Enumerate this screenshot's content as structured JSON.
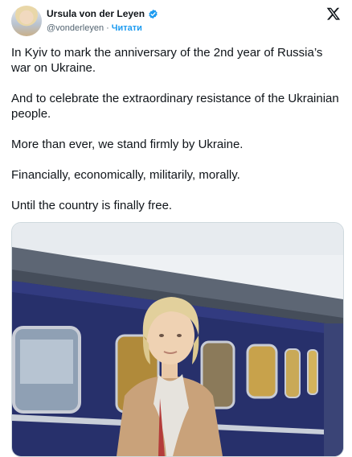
{
  "author": {
    "display_name": "Ursula von der Leyen",
    "handle": "@vonderleyen",
    "separator": "·",
    "follow_label": "Читати",
    "verified_icon": "verified-badge-icon"
  },
  "platform_icon": "x-logo-icon",
  "tweet": {
    "paragraphs": [
      "In Kyiv to mark the anniversary of the 2nd year of Russia’s war on Ukraine.",
      "And to celebrate the extraordinary resistance of the Ukrainian people.",
      "More than ever, we stand firmly by Ukraine.",
      "Financially, economically, militarily, morally.",
      "Until the country is finally free."
    ]
  },
  "colors": {
    "accent": "#1d9bf0",
    "text": "#0f1419",
    "muted": "#536471",
    "train": "#27306b"
  }
}
